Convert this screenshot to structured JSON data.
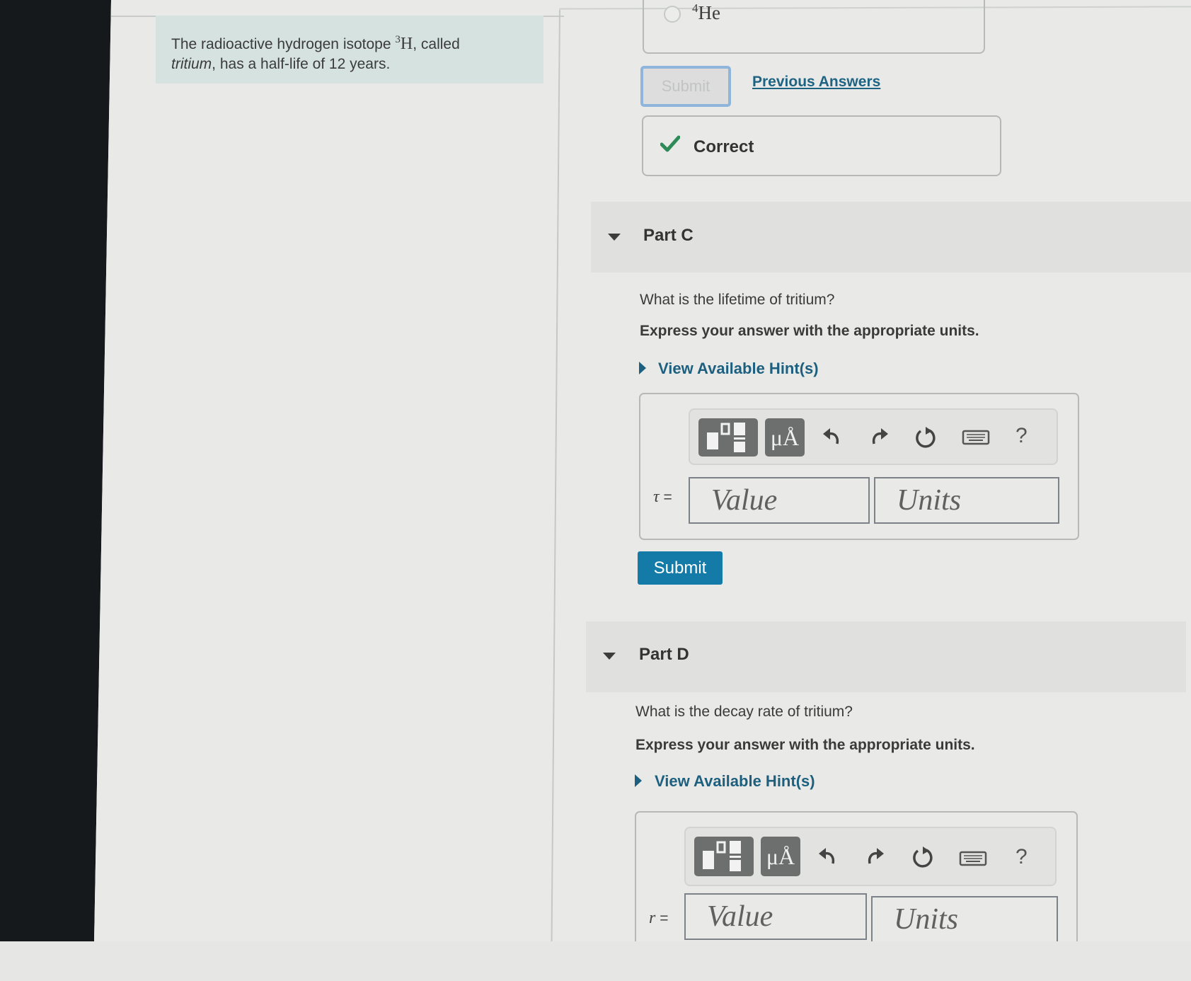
{
  "problem": {
    "intro_prefix": "The radioactive hydrogen isotope ",
    "isotope_mass": "3",
    "isotope_symbol": "H",
    "intro_suffix": ", called",
    "italic_word": "tritium",
    "intro_line2": ", has a half-life of 12 years."
  },
  "part_b": {
    "option_mass": "4",
    "option_symbol": "He",
    "submit_label": "Submit",
    "previous_answers_label": "Previous Answers",
    "feedback_label": "Correct",
    "feedback_icon": "checkmark-icon",
    "feedback_color": "#2e8b57"
  },
  "part_c": {
    "title": "Part C",
    "question": "What is the lifetime of tritium?",
    "instruction": "Express your answer with the appropriate units.",
    "hint_label": "View Available Hint(s)",
    "variable": "τ",
    "equals": "=",
    "value_placeholder": "Value",
    "units_placeholder": "Units",
    "units_button": "μÅ",
    "help": "?",
    "submit_label": "Submit"
  },
  "part_d": {
    "title": "Part D",
    "question": "What is the decay rate of tritium?",
    "instruction": "Express your answer with the appropriate units.",
    "hint_label": "View Available Hint(s)",
    "variable": "r",
    "equals": "=",
    "value_placeholder": "Value",
    "units_placeholder": "Units",
    "units_button": "μÅ",
    "help": "?"
  },
  "colors": {
    "accent": "#147ba8",
    "link": "#1d5f7e",
    "info_bg": "#d6e2df"
  }
}
